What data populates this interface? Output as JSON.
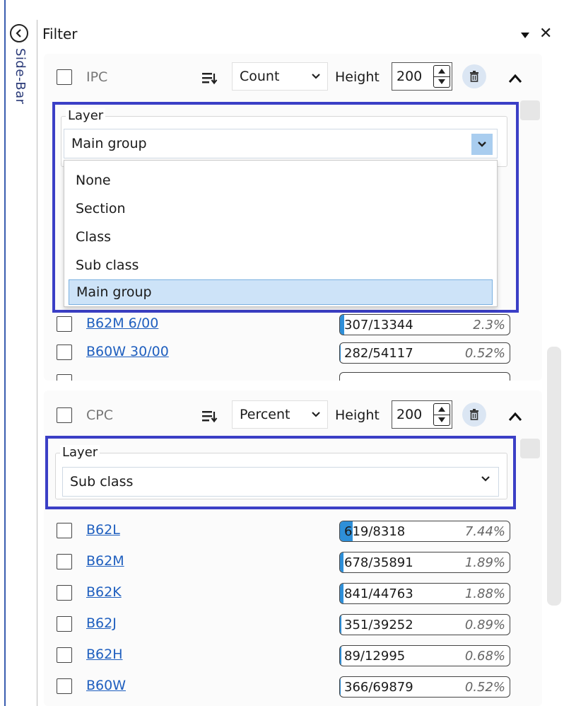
{
  "sidebar": {
    "label": "Side-Bar"
  },
  "header": {
    "title": "Filter"
  },
  "ipc": {
    "name": "IPC",
    "mode": "Count",
    "height_label": "Height",
    "height_value": "200",
    "layer": {
      "legend": "Layer",
      "selected": "Main group",
      "options": [
        "None",
        "Section",
        "Class",
        "Sub class",
        "Main group"
      ]
    },
    "rows": [
      {
        "code": "B62M 6/00",
        "count": "307/13344",
        "pct": "2.3%",
        "fraction": 0.023
      },
      {
        "code": "B60W 30/00",
        "count": "282/54117",
        "pct": "0.52%",
        "fraction": 0.0052
      }
    ]
  },
  "cpc": {
    "name": "CPC",
    "mode": "Percent",
    "height_label": "Height",
    "height_value": "200",
    "layer": {
      "legend": "Layer",
      "selected": "Sub class"
    },
    "rows": [
      {
        "code": "B62L",
        "count": "619/8318",
        "pct": "7.44%",
        "fraction": 0.0744
      },
      {
        "code": "B62M",
        "count": "678/35891",
        "pct": "1.89%",
        "fraction": 0.0189
      },
      {
        "code": "B62K",
        "count": "841/44763",
        "pct": "1.88%",
        "fraction": 0.0188
      },
      {
        "code": "B62J",
        "count": "351/39252",
        "pct": "0.89%",
        "fraction": 0.0089
      },
      {
        "code": "B62H",
        "count": "89/12995",
        "pct": "0.68%",
        "fraction": 0.0068
      },
      {
        "code": "B60W",
        "count": "366/69879",
        "pct": "0.52%",
        "fraction": 0.0052
      }
    ]
  },
  "colors": {
    "accent": "#3b3fc6",
    "link": "#1f5fbf",
    "bar_fill": "#2e8fd8",
    "dropdown_selected": "#cde3f8"
  }
}
